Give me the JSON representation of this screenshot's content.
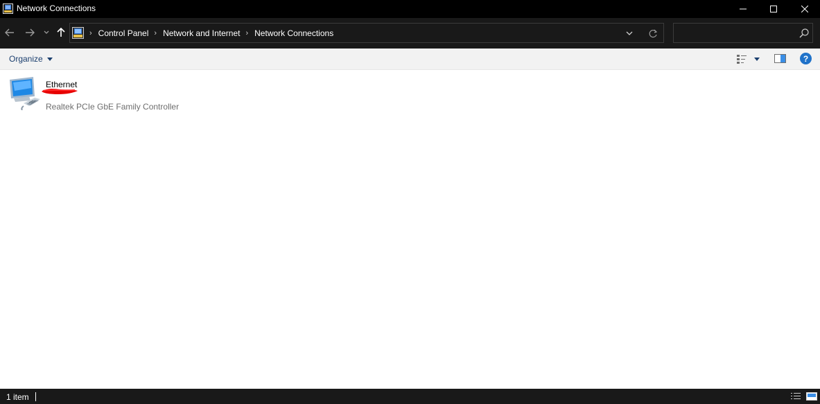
{
  "window": {
    "title": "Network Connections",
    "minimize_icon": "minimize-icon",
    "maximize_icon": "maximize-icon",
    "close_icon": "close-icon"
  },
  "nav": {
    "back_icon": "arrow-left-icon",
    "forward_icon": "arrow-right-icon",
    "recent_icon": "chevron-down-icon",
    "up_icon": "arrow-up-icon"
  },
  "address": {
    "breadcrumbs": [
      "Control Panel",
      "Network and Internet",
      "Network Connections"
    ],
    "separator": "›",
    "dropdown_icon": "chevron-down-icon",
    "refresh_icon": "refresh-icon"
  },
  "search": {
    "placeholder": "",
    "icon": "search-icon"
  },
  "toolbar": {
    "organize_label": "Organize",
    "help_label": "?"
  },
  "connections": [
    {
      "name": "Ethernet",
      "device": "Realtek PCIe GbE Family Controller",
      "icon": "network-adapter-icon"
    }
  ],
  "statusbar": {
    "item_count": "1 item"
  },
  "colors": {
    "titlebar_bg": "#000000",
    "navbar_bg": "#191919",
    "commandbar_bg": "#f2f2f2",
    "content_bg": "#ffffff",
    "accent_link": "#1a3e6e",
    "help_blue": "#1f72c9",
    "status_scribble": "#e60000"
  }
}
